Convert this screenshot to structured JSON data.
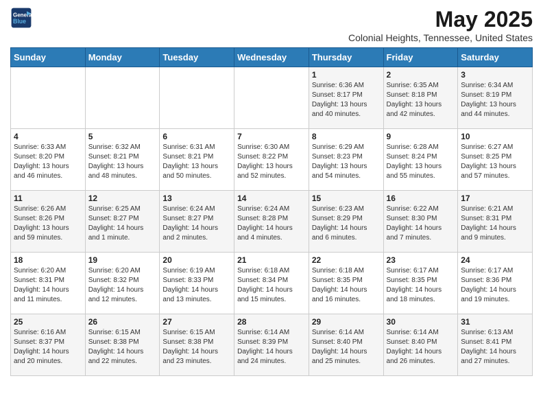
{
  "header": {
    "logo_line1": "General",
    "logo_line2": "Blue",
    "title": "May 2025",
    "subtitle": "Colonial Heights, Tennessee, United States"
  },
  "weekdays": [
    "Sunday",
    "Monday",
    "Tuesday",
    "Wednesday",
    "Thursday",
    "Friday",
    "Saturday"
  ],
  "weeks": [
    [
      {
        "day": "",
        "content": ""
      },
      {
        "day": "",
        "content": ""
      },
      {
        "day": "",
        "content": ""
      },
      {
        "day": "",
        "content": ""
      },
      {
        "day": "1",
        "content": "Sunrise: 6:36 AM\nSunset: 8:17 PM\nDaylight: 13 hours\nand 40 minutes."
      },
      {
        "day": "2",
        "content": "Sunrise: 6:35 AM\nSunset: 8:18 PM\nDaylight: 13 hours\nand 42 minutes."
      },
      {
        "day": "3",
        "content": "Sunrise: 6:34 AM\nSunset: 8:19 PM\nDaylight: 13 hours\nand 44 minutes."
      }
    ],
    [
      {
        "day": "4",
        "content": "Sunrise: 6:33 AM\nSunset: 8:20 PM\nDaylight: 13 hours\nand 46 minutes."
      },
      {
        "day": "5",
        "content": "Sunrise: 6:32 AM\nSunset: 8:21 PM\nDaylight: 13 hours\nand 48 minutes."
      },
      {
        "day": "6",
        "content": "Sunrise: 6:31 AM\nSunset: 8:21 PM\nDaylight: 13 hours\nand 50 minutes."
      },
      {
        "day": "7",
        "content": "Sunrise: 6:30 AM\nSunset: 8:22 PM\nDaylight: 13 hours\nand 52 minutes."
      },
      {
        "day": "8",
        "content": "Sunrise: 6:29 AM\nSunset: 8:23 PM\nDaylight: 13 hours\nand 54 minutes."
      },
      {
        "day": "9",
        "content": "Sunrise: 6:28 AM\nSunset: 8:24 PM\nDaylight: 13 hours\nand 55 minutes."
      },
      {
        "day": "10",
        "content": "Sunrise: 6:27 AM\nSunset: 8:25 PM\nDaylight: 13 hours\nand 57 minutes."
      }
    ],
    [
      {
        "day": "11",
        "content": "Sunrise: 6:26 AM\nSunset: 8:26 PM\nDaylight: 13 hours\nand 59 minutes."
      },
      {
        "day": "12",
        "content": "Sunrise: 6:25 AM\nSunset: 8:27 PM\nDaylight: 14 hours\nand 1 minute."
      },
      {
        "day": "13",
        "content": "Sunrise: 6:24 AM\nSunset: 8:27 PM\nDaylight: 14 hours\nand 2 minutes."
      },
      {
        "day": "14",
        "content": "Sunrise: 6:24 AM\nSunset: 8:28 PM\nDaylight: 14 hours\nand 4 minutes."
      },
      {
        "day": "15",
        "content": "Sunrise: 6:23 AM\nSunset: 8:29 PM\nDaylight: 14 hours\nand 6 minutes."
      },
      {
        "day": "16",
        "content": "Sunrise: 6:22 AM\nSunset: 8:30 PM\nDaylight: 14 hours\nand 7 minutes."
      },
      {
        "day": "17",
        "content": "Sunrise: 6:21 AM\nSunset: 8:31 PM\nDaylight: 14 hours\nand 9 minutes."
      }
    ],
    [
      {
        "day": "18",
        "content": "Sunrise: 6:20 AM\nSunset: 8:31 PM\nDaylight: 14 hours\nand 11 minutes."
      },
      {
        "day": "19",
        "content": "Sunrise: 6:20 AM\nSunset: 8:32 PM\nDaylight: 14 hours\nand 12 minutes."
      },
      {
        "day": "20",
        "content": "Sunrise: 6:19 AM\nSunset: 8:33 PM\nDaylight: 14 hours\nand 13 minutes."
      },
      {
        "day": "21",
        "content": "Sunrise: 6:18 AM\nSunset: 8:34 PM\nDaylight: 14 hours\nand 15 minutes."
      },
      {
        "day": "22",
        "content": "Sunrise: 6:18 AM\nSunset: 8:35 PM\nDaylight: 14 hours\nand 16 minutes."
      },
      {
        "day": "23",
        "content": "Sunrise: 6:17 AM\nSunset: 8:35 PM\nDaylight: 14 hours\nand 18 minutes."
      },
      {
        "day": "24",
        "content": "Sunrise: 6:17 AM\nSunset: 8:36 PM\nDaylight: 14 hours\nand 19 minutes."
      }
    ],
    [
      {
        "day": "25",
        "content": "Sunrise: 6:16 AM\nSunset: 8:37 PM\nDaylight: 14 hours\nand 20 minutes."
      },
      {
        "day": "26",
        "content": "Sunrise: 6:15 AM\nSunset: 8:38 PM\nDaylight: 14 hours\nand 22 minutes."
      },
      {
        "day": "27",
        "content": "Sunrise: 6:15 AM\nSunset: 8:38 PM\nDaylight: 14 hours\nand 23 minutes."
      },
      {
        "day": "28",
        "content": "Sunrise: 6:14 AM\nSunset: 8:39 PM\nDaylight: 14 hours\nand 24 minutes."
      },
      {
        "day": "29",
        "content": "Sunrise: 6:14 AM\nSunset: 8:40 PM\nDaylight: 14 hours\nand 25 minutes."
      },
      {
        "day": "30",
        "content": "Sunrise: 6:14 AM\nSunset: 8:40 PM\nDaylight: 14 hours\nand 26 minutes."
      },
      {
        "day": "31",
        "content": "Sunrise: 6:13 AM\nSunset: 8:41 PM\nDaylight: 14 hours\nand 27 minutes."
      }
    ]
  ]
}
